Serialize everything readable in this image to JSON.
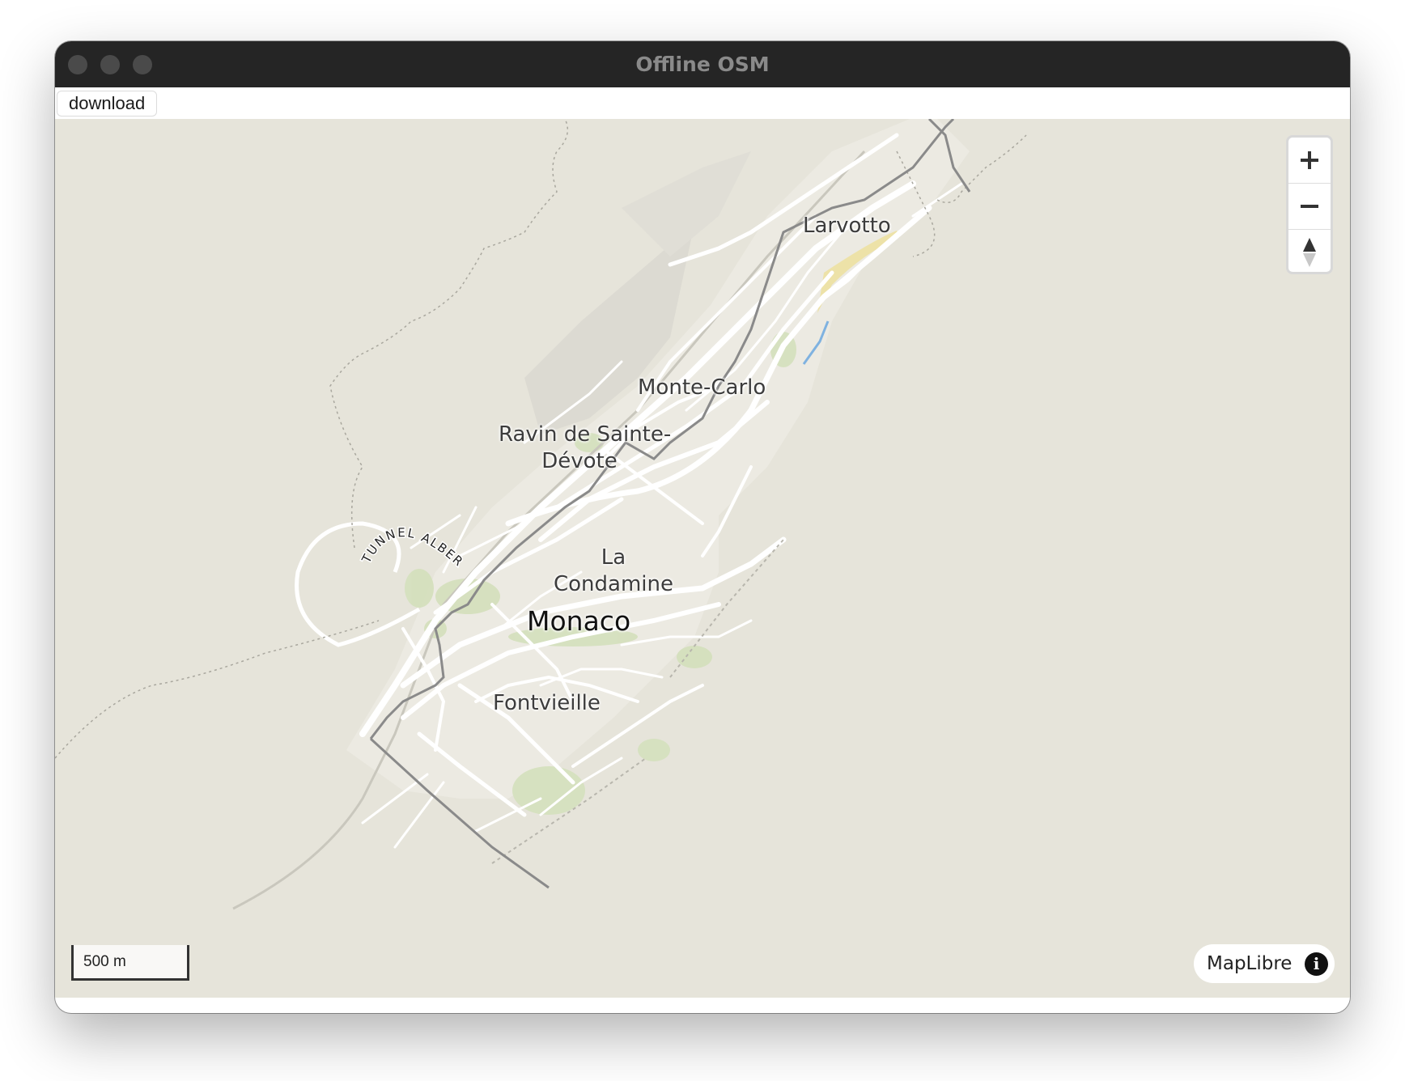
{
  "window": {
    "title": "Offline OSM"
  },
  "toolbar": {
    "download_label": "download"
  },
  "map": {
    "places": {
      "larvotto": "Larvotto",
      "monte_carlo": "Monte-Carlo",
      "ravin_line1": "Ravin de Sainte-",
      "ravin_line2": "Dévote",
      "condamine_line1": "La",
      "condamine_line2": "Condamine",
      "monaco": "Monaco",
      "fontvieille": "Fontvieille",
      "tunnel": "TUNNEL ALBERT II"
    },
    "scale_label": "500 m",
    "attribution": "MapLibre",
    "colors": {
      "land": "#e6e4da",
      "roads": "#ffffff",
      "parks": "#d4e0bc",
      "border": "#8a8a8a",
      "beach": "#ede2a8",
      "stream": "#7fb2e0"
    }
  },
  "controls": {
    "zoom_in_icon": "plus-icon",
    "zoom_out_icon": "minus-icon",
    "compass_icon": "compass-icon",
    "info_icon": "info-icon"
  }
}
